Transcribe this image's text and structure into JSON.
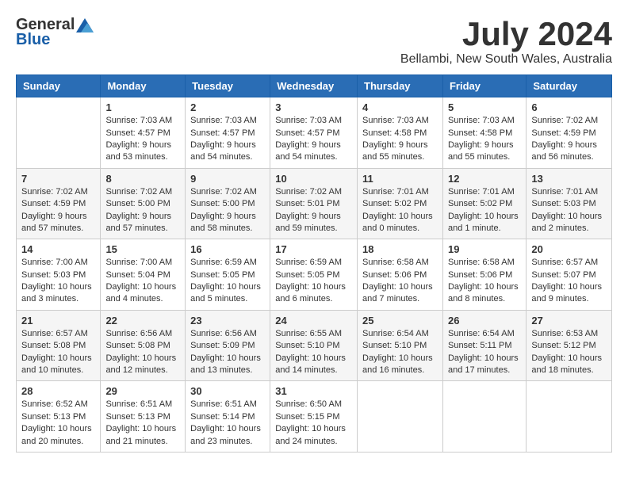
{
  "logo": {
    "general": "General",
    "blue": "Blue"
  },
  "title": "July 2024",
  "location": "Bellambi, New South Wales, Australia",
  "weekdays": [
    "Sunday",
    "Monday",
    "Tuesday",
    "Wednesday",
    "Thursday",
    "Friday",
    "Saturday"
  ],
  "weeks": [
    [
      {
        "day": "",
        "info": ""
      },
      {
        "day": "1",
        "info": "Sunrise: 7:03 AM\nSunset: 4:57 PM\nDaylight: 9 hours\nand 53 minutes."
      },
      {
        "day": "2",
        "info": "Sunrise: 7:03 AM\nSunset: 4:57 PM\nDaylight: 9 hours\nand 54 minutes."
      },
      {
        "day": "3",
        "info": "Sunrise: 7:03 AM\nSunset: 4:57 PM\nDaylight: 9 hours\nand 54 minutes."
      },
      {
        "day": "4",
        "info": "Sunrise: 7:03 AM\nSunset: 4:58 PM\nDaylight: 9 hours\nand 55 minutes."
      },
      {
        "day": "5",
        "info": "Sunrise: 7:03 AM\nSunset: 4:58 PM\nDaylight: 9 hours\nand 55 minutes."
      },
      {
        "day": "6",
        "info": "Sunrise: 7:02 AM\nSunset: 4:59 PM\nDaylight: 9 hours\nand 56 minutes."
      }
    ],
    [
      {
        "day": "7",
        "info": "Sunrise: 7:02 AM\nSunset: 4:59 PM\nDaylight: 9 hours\nand 57 minutes."
      },
      {
        "day": "8",
        "info": "Sunrise: 7:02 AM\nSunset: 5:00 PM\nDaylight: 9 hours\nand 57 minutes."
      },
      {
        "day": "9",
        "info": "Sunrise: 7:02 AM\nSunset: 5:00 PM\nDaylight: 9 hours\nand 58 minutes."
      },
      {
        "day": "10",
        "info": "Sunrise: 7:02 AM\nSunset: 5:01 PM\nDaylight: 9 hours\nand 59 minutes."
      },
      {
        "day": "11",
        "info": "Sunrise: 7:01 AM\nSunset: 5:02 PM\nDaylight: 10 hours\nand 0 minutes."
      },
      {
        "day": "12",
        "info": "Sunrise: 7:01 AM\nSunset: 5:02 PM\nDaylight: 10 hours\nand 1 minute."
      },
      {
        "day": "13",
        "info": "Sunrise: 7:01 AM\nSunset: 5:03 PM\nDaylight: 10 hours\nand 2 minutes."
      }
    ],
    [
      {
        "day": "14",
        "info": "Sunrise: 7:00 AM\nSunset: 5:03 PM\nDaylight: 10 hours\nand 3 minutes."
      },
      {
        "day": "15",
        "info": "Sunrise: 7:00 AM\nSunset: 5:04 PM\nDaylight: 10 hours\nand 4 minutes."
      },
      {
        "day": "16",
        "info": "Sunrise: 6:59 AM\nSunset: 5:05 PM\nDaylight: 10 hours\nand 5 minutes."
      },
      {
        "day": "17",
        "info": "Sunrise: 6:59 AM\nSunset: 5:05 PM\nDaylight: 10 hours\nand 6 minutes."
      },
      {
        "day": "18",
        "info": "Sunrise: 6:58 AM\nSunset: 5:06 PM\nDaylight: 10 hours\nand 7 minutes."
      },
      {
        "day": "19",
        "info": "Sunrise: 6:58 AM\nSunset: 5:06 PM\nDaylight: 10 hours\nand 8 minutes."
      },
      {
        "day": "20",
        "info": "Sunrise: 6:57 AM\nSunset: 5:07 PM\nDaylight: 10 hours\nand 9 minutes."
      }
    ],
    [
      {
        "day": "21",
        "info": "Sunrise: 6:57 AM\nSunset: 5:08 PM\nDaylight: 10 hours\nand 10 minutes."
      },
      {
        "day": "22",
        "info": "Sunrise: 6:56 AM\nSunset: 5:08 PM\nDaylight: 10 hours\nand 12 minutes."
      },
      {
        "day": "23",
        "info": "Sunrise: 6:56 AM\nSunset: 5:09 PM\nDaylight: 10 hours\nand 13 minutes."
      },
      {
        "day": "24",
        "info": "Sunrise: 6:55 AM\nSunset: 5:10 PM\nDaylight: 10 hours\nand 14 minutes."
      },
      {
        "day": "25",
        "info": "Sunrise: 6:54 AM\nSunset: 5:10 PM\nDaylight: 10 hours\nand 16 minutes."
      },
      {
        "day": "26",
        "info": "Sunrise: 6:54 AM\nSunset: 5:11 PM\nDaylight: 10 hours\nand 17 minutes."
      },
      {
        "day": "27",
        "info": "Sunrise: 6:53 AM\nSunset: 5:12 PM\nDaylight: 10 hours\nand 18 minutes."
      }
    ],
    [
      {
        "day": "28",
        "info": "Sunrise: 6:52 AM\nSunset: 5:13 PM\nDaylight: 10 hours\nand 20 minutes."
      },
      {
        "day": "29",
        "info": "Sunrise: 6:51 AM\nSunset: 5:13 PM\nDaylight: 10 hours\nand 21 minutes."
      },
      {
        "day": "30",
        "info": "Sunrise: 6:51 AM\nSunset: 5:14 PM\nDaylight: 10 hours\nand 23 minutes."
      },
      {
        "day": "31",
        "info": "Sunrise: 6:50 AM\nSunset: 5:15 PM\nDaylight: 10 hours\nand 24 minutes."
      },
      {
        "day": "",
        "info": ""
      },
      {
        "day": "",
        "info": ""
      },
      {
        "day": "",
        "info": ""
      }
    ]
  ]
}
